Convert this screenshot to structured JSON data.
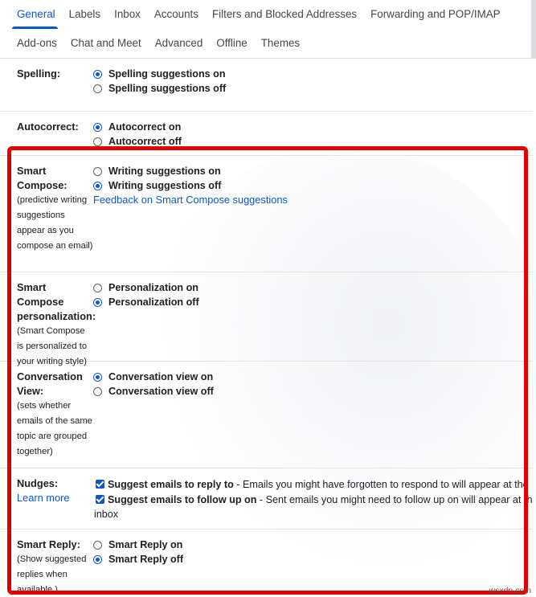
{
  "tabs": {
    "row1": [
      "General",
      "Labels",
      "Inbox",
      "Accounts",
      "Filters and Blocked Addresses",
      "Forwarding and POP/IMAP"
    ],
    "row2": [
      "Add-ons",
      "Chat and Meet",
      "Advanced",
      "Offline",
      "Themes"
    ],
    "active": "General"
  },
  "spelling": {
    "label": "Spelling:",
    "on": "Spelling suggestions on",
    "off": "Spelling suggestions off"
  },
  "autocorrect": {
    "label": "Autocorrect:",
    "on": "Autocorrect on",
    "off": "Autocorrect off"
  },
  "smart_compose": {
    "label": "Smart Compose:",
    "desc": "(predictive writing suggestions appear as you compose an email)",
    "on": "Writing suggestions on",
    "off": "Writing suggestions off",
    "feedback_link": "Feedback on Smart Compose suggestions"
  },
  "personalization": {
    "label": "Smart Compose personalization:",
    "desc": "(Smart Compose is personalized to your writing style)",
    "on": "Personalization on",
    "off": "Personalization off"
  },
  "conversation": {
    "label": "Conversation View:",
    "desc": "(sets whether emails of the same topic are grouped together)",
    "on": "Conversation view on",
    "off": "Conversation view off"
  },
  "nudges": {
    "label": "Nudges:",
    "learn_more": "Learn more",
    "reply_bold": "Suggest emails to reply to",
    "reply_rest": " - Emails you might have forgotten to respond to will appear at the",
    "follow_bold": "Suggest emails to follow up on",
    "follow_rest": " - Sent emails you might need to follow up on will appear at the",
    "follow_cont": "inbox"
  },
  "smart_reply": {
    "label": "Smart Reply:",
    "desc": "(Show suggested replies when available.)",
    "on": "Smart Reply on",
    "off": "Smart Reply off"
  },
  "watermark": "wsxdn.com",
  "colors": {
    "accent": "#0b57d0",
    "highlight": "#e40000"
  }
}
